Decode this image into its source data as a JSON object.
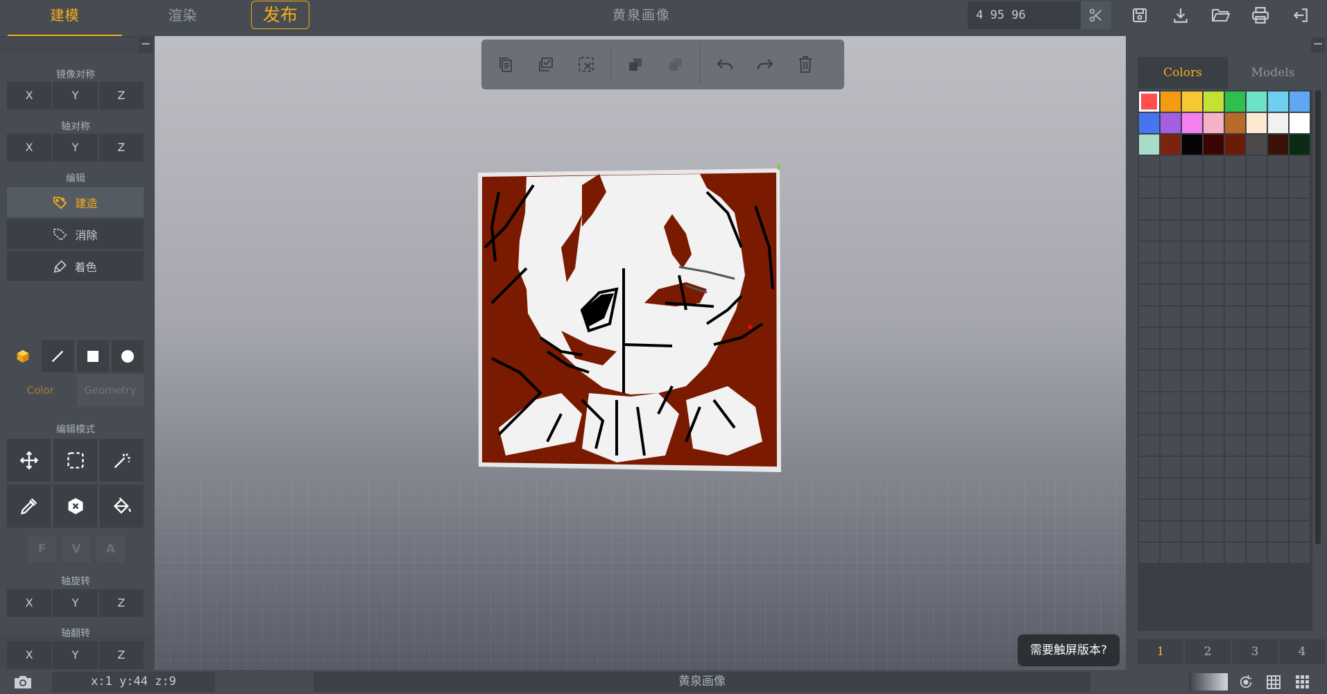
{
  "header": {
    "tabs": [
      {
        "label": "建模",
        "active": true
      },
      {
        "label": "渲染",
        "active": false
      }
    ],
    "publish_label": "发布",
    "doc_title": "黄泉画像",
    "coord_input": "4 95 96",
    "icons": [
      "scissors-icon",
      "save-icon",
      "download-icon",
      "open-folder-icon",
      "print-icon",
      "exit-icon"
    ]
  },
  "left_panel": {
    "collapse_label": "−",
    "mirror": {
      "label": "镜像对称",
      "buttons": [
        "X",
        "Y",
        "Z"
      ]
    },
    "axis_sym": {
      "label": "轴对称",
      "buttons": [
        "X",
        "Y",
        "Z"
      ]
    },
    "edit": {
      "label": "编辑",
      "modes": [
        {
          "label": "建造",
          "icon": "build-tag-icon",
          "active": true
        },
        {
          "label": "消除",
          "icon": "erase-icon",
          "active": false
        },
        {
          "label": "着色",
          "icon": "paint-brush-icon",
          "active": false
        }
      ]
    },
    "shapes": [
      "cube-icon",
      "line-icon",
      "square-icon",
      "circle-icon"
    ],
    "color_geometry": {
      "color": "Color",
      "geometry": "Geometry"
    },
    "edit_mode": {
      "label": "编辑模式",
      "tools": [
        "move-icon",
        "select-rect-icon",
        "magic-wand-icon",
        "eyedropper-icon",
        "hex-remove-icon",
        "paint-bucket-icon"
      ],
      "fva": [
        "F",
        "V",
        "A"
      ]
    },
    "axis_rotate": {
      "label": "轴旋转",
      "buttons": [
        "X",
        "Y",
        "Z"
      ]
    },
    "axis_flip": {
      "label": "轴翻转",
      "buttons": [
        "X",
        "Y",
        "Z"
      ]
    }
  },
  "toolbar": {
    "icons": [
      "copy-icon",
      "paste-icon",
      "clear-selection-icon",
      "duplicate-icon",
      "merge-icon",
      "undo-icon",
      "redo-icon",
      "delete-icon"
    ]
  },
  "right_panel": {
    "collapse_label": "−",
    "tabs": [
      {
        "label": "Colors",
        "active": true
      },
      {
        "label": "Models",
        "active": false
      }
    ],
    "swatches": [
      "#ff4f4f",
      "#f39c12",
      "#f6c933",
      "#c3e235",
      "#2ebf4f",
      "#6ee2c9",
      "#6ecff0",
      "#5fa6f5",
      "#4575f0",
      "#a35fe0",
      "#f57ff0",
      "#f7b0c6",
      "#b86a2a",
      "#fde9d2",
      "#f1f1f1",
      "#ffffff",
      "#a8dcc8",
      "#7a2410",
      "#050505",
      "#3d0404",
      "#6b1c07",
      "#4a4a4a",
      "#3b1207",
      "#0b2a14"
    ],
    "selected_swatch": 0,
    "empty_rows": 19,
    "pages": [
      "1",
      "2",
      "3",
      "4"
    ],
    "active_page": 0
  },
  "popup": {
    "text": "需要触屏版本?"
  },
  "status": {
    "coords": "x:1 y:44 z:9",
    "title": "黄泉画像"
  }
}
